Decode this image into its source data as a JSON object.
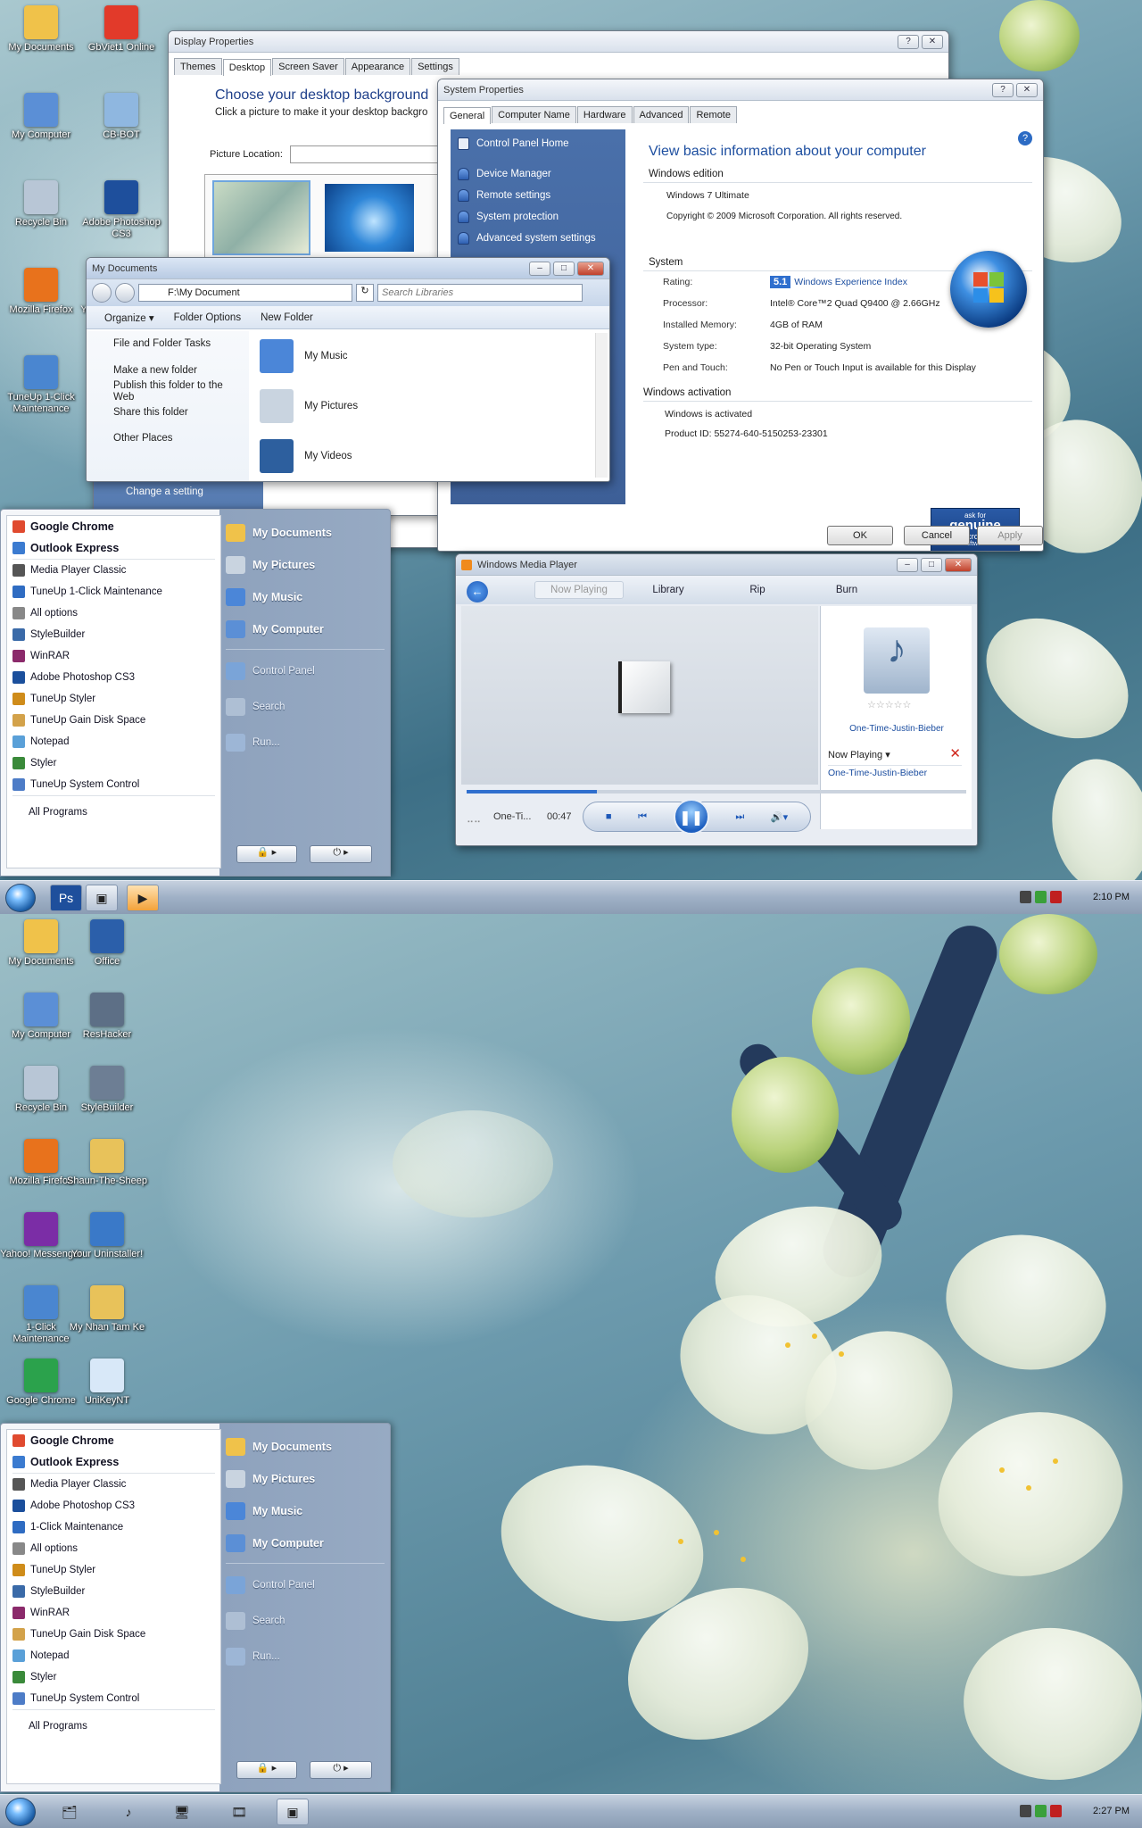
{
  "top": {
    "desktop_icons": [
      {
        "label": "My Documents",
        "icon": "my-documents-icon"
      },
      {
        "label": "GbViet1 Online",
        "icon": "gbviet-icon"
      },
      {
        "label": "My Computer",
        "icon": "computer-icon"
      },
      {
        "label": "CB-BOT",
        "icon": "magnifier-icon"
      },
      {
        "label": "Recycle Bin",
        "icon": "recycle-bin-icon"
      },
      {
        "label": "Adobe Photoshop CS3",
        "icon": "photoshop-icon"
      },
      {
        "label": "Mozilla Firefox",
        "icon": "firefox-icon"
      },
      {
        "label": "Yahoo! Messenger",
        "icon": "yahoo-icon"
      },
      {
        "label": "TuneUp 1-Click Maintenance",
        "icon": "tuneup-icon"
      }
    ],
    "display_properties": {
      "title": "Display Properties",
      "tabs": [
        "Themes",
        "Desktop",
        "Screen Saver",
        "Appearance",
        "Settings"
      ],
      "active_tab": "Desktop",
      "heading": "Choose your desktop background",
      "subheading": "Click a picture to make it your desktop backgro",
      "picture_location_label": "Picture Location:"
    },
    "system_properties": {
      "title": "System Properties",
      "tabs": [
        "General",
        "Computer Name",
        "Hardware",
        "Advanced",
        "Remote"
      ],
      "active_tab": "General",
      "nav_home": "Control Panel Home",
      "nav": [
        "Device Manager",
        "Remote settings",
        "System protection",
        "Advanced system settings"
      ],
      "heading": "View basic information about your computer",
      "edition_section": "Windows edition",
      "edition": "Windows 7 Ultimate",
      "copyright": "Copyright © 2009 Microsoft Corporation. All rights reserved.",
      "system_section": "System",
      "rows": [
        {
          "k": "Rating:",
          "v": "Windows Experience Index"
        },
        {
          "k": "Processor:",
          "v": "Intel® Core™2 Quad Q9400 @ 2.66GHz"
        },
        {
          "k": "Installed Memory:",
          "v": "4GB of RAM"
        },
        {
          "k": "System type:",
          "v": "32-bit Operating System"
        },
        {
          "k": "Pen and Touch:",
          "v": "No Pen or Touch Input is available for this Display"
        }
      ],
      "rating_badge": "5.1",
      "activation_section": "Windows activation",
      "activated": "Windows is activated",
      "product_id": "Product ID:  55274-640-5150253-23301",
      "genuine_top": "ask for",
      "genuine": "genuine",
      "genuine_ms": "Microsoft",
      "genuine_sw": "software",
      "ok": "OK",
      "cancel": "Cancel",
      "apply": "Apply"
    },
    "explorer": {
      "title": "My Documents",
      "address": "F:\\My Document",
      "search_placeholder": "Search Libraries",
      "toolbar": [
        "Organize ▾",
        "Folder Options",
        "New Folder"
      ],
      "tasks_header": "File and Folder Tasks",
      "tasks": [
        "Make a new folder",
        "Publish this folder to the Web",
        "Share this folder"
      ],
      "other_places": "Other Places",
      "items": [
        "My Music",
        "My Pictures",
        "My Videos"
      ],
      "behind_text": "Change a setting"
    },
    "start_menu": {
      "left": [
        {
          "label": "Google Chrome",
          "bold": true,
          "color": "#e04a2f"
        },
        {
          "label": "Outlook Express",
          "bold": true,
          "color": "#3b7bd0"
        },
        {
          "label": "Media Player Classic",
          "color": "#555"
        },
        {
          "label": "TuneUp 1-Click Maintenance",
          "color": "#2f6cc2"
        },
        {
          "label": "All options",
          "color": "#888"
        },
        {
          "label": "StyleBuilder",
          "color": "#3a6aa8"
        },
        {
          "label": "WinRAR",
          "color": "#8b2a6b"
        },
        {
          "label": "Adobe Photoshop CS3",
          "color": "#1b4f9c"
        },
        {
          "label": "TuneUp Styler",
          "color": "#cf8c1a"
        },
        {
          "label": "TuneUp Gain Disk Space",
          "color": "#d3a24a"
        },
        {
          "label": "Notepad",
          "color": "#5aa0d8"
        },
        {
          "label": "Styler",
          "color": "#3a8a3a"
        },
        {
          "label": "TuneUp System Control",
          "color": "#4d7cc7"
        }
      ],
      "all_programs": "All Programs",
      "right": [
        {
          "label": "My Documents",
          "bold": true
        },
        {
          "label": "My Pictures",
          "bold": true
        },
        {
          "label": "My Music",
          "bold": true
        },
        {
          "label": "My Computer",
          "bold": true
        },
        {
          "label": "Control Panel"
        },
        {
          "label": "Search"
        },
        {
          "label": "Run..."
        }
      ]
    },
    "wmp": {
      "title": "Windows Media Player",
      "tabs": [
        "Now Playing",
        "Library",
        "Rip",
        "Burn"
      ],
      "track": "One-Time-Justin-Bieber",
      "now_playing": "Now Playing",
      "playlist_item": "One-Time-Justin-Bieber",
      "short_title": "One-Ti...",
      "time": "00:47",
      "progress": 0.26
    },
    "taskbar": {
      "clock": "2:10 PM"
    }
  },
  "bottom": {
    "desktop_icons": [
      {
        "label": "My Documents",
        "icon": "my-documents-icon"
      },
      {
        "label": "Office",
        "icon": "word-icon"
      },
      {
        "label": "My Computer",
        "icon": "computer-icon"
      },
      {
        "label": "ResHacker",
        "icon": "reshacker-icon"
      },
      {
        "label": "Recycle Bin",
        "icon": "recycle-bin-icon"
      },
      {
        "label": "StyleBuilder",
        "icon": "stylebuilder-icon"
      },
      {
        "label": "Mozilla Firefox",
        "icon": "firefox-icon"
      },
      {
        "label": "Shaun-The-Sheep",
        "icon": "folder-icon"
      },
      {
        "label": "Yahoo! Messenger",
        "icon": "yahoo-icon"
      },
      {
        "label": "Your Uninstaller!",
        "icon": "uninstaller-icon"
      },
      {
        "label": "1-Click Maintenance",
        "icon": "tuneup-icon"
      },
      {
        "label": "My Nhan Tam Ke",
        "icon": "folder-icon"
      },
      {
        "label": "Google Chrome",
        "icon": "chrome-icon"
      },
      {
        "label": "UniKeyNT",
        "icon": "unikey-icon"
      }
    ],
    "start_menu": {
      "left": [
        {
          "label": "Google Chrome",
          "bold": true,
          "color": "#e04a2f"
        },
        {
          "label": "Outlook Express",
          "bold": true,
          "color": "#3b7bd0"
        },
        {
          "label": "Media Player Classic",
          "color": "#555"
        },
        {
          "label": "Adobe Photoshop CS3",
          "color": "#1b4f9c"
        },
        {
          "label": "1-Click Maintenance",
          "color": "#2f6cc2"
        },
        {
          "label": "All options",
          "color": "#888"
        },
        {
          "label": "TuneUp Styler",
          "color": "#cf8c1a"
        },
        {
          "label": "StyleBuilder",
          "color": "#3a6aa8"
        },
        {
          "label": "WinRAR",
          "color": "#8b2a6b"
        },
        {
          "label": "TuneUp Gain Disk Space",
          "color": "#d3a24a"
        },
        {
          "label": "Notepad",
          "color": "#5aa0d8"
        },
        {
          "label": "Styler",
          "color": "#3a8a3a"
        },
        {
          "label": "TuneUp System Control",
          "color": "#4d7cc7"
        }
      ],
      "all_programs": "All Programs",
      "right": [
        {
          "label": "My Documents",
          "bold": true
        },
        {
          "label": "My Pictures",
          "bold": true
        },
        {
          "label": "My Music",
          "bold": true
        },
        {
          "label": "My Computer",
          "bold": true
        },
        {
          "label": "Control Panel"
        },
        {
          "label": "Search"
        },
        {
          "label": "Run..."
        }
      ]
    },
    "taskbar": {
      "clock": "2:27 PM"
    }
  }
}
